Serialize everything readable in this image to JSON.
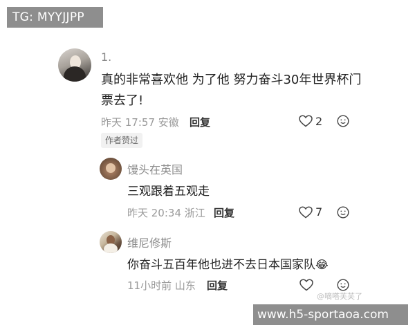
{
  "top_tag": "TG: MYYJJPP",
  "main_comment": {
    "index": "1.",
    "text": "真的非常喜欢他 为了他 努力奋斗30年世界杯门票去了!",
    "time_location": "昨天 17:57 安徽",
    "reply_label": "回复",
    "like_count": "2",
    "author_liked_badge": "作者赞过"
  },
  "replies": [
    {
      "username": "馒头在英国",
      "text": "三观跟着五观走",
      "time_location": "昨天 20:34 浙江",
      "reply_label": "回复",
      "like_count": "7"
    },
    {
      "username": "维尼修斯",
      "text": "你奋斗五百年他也进不去日本国家队",
      "emoji": "😂",
      "time_location": "11小时前 山东",
      "reply_label": "回复",
      "like_count": ""
    }
  ],
  "watermark": {
    "user": "@嘀嗒芙芙了",
    "url": "www.h5-sportaoa.com"
  },
  "icons": {
    "like": "heart-outline-icon",
    "more": "smile-face-icon"
  },
  "colors": {
    "text": "#222222",
    "meta": "#9a9a9a",
    "tag_bg": "#8e8e8e"
  }
}
